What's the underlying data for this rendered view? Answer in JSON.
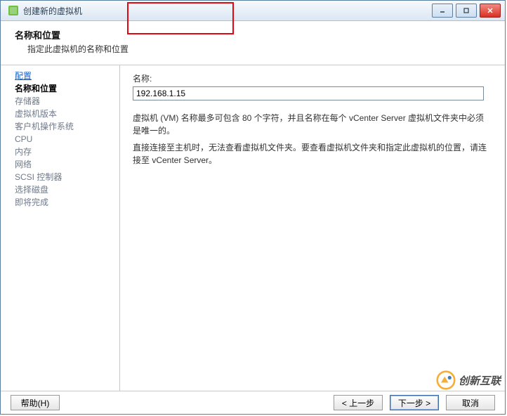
{
  "titlebar": {
    "title": "创建新的虚拟机",
    "min_icon": "min",
    "max_icon": "max",
    "close_icon": "x"
  },
  "header": {
    "title": "名称和位置",
    "subtitle": "指定此虚拟机的名称和位置"
  },
  "sidebar": {
    "items": [
      {
        "label": "配置",
        "state": "link"
      },
      {
        "label": "名称和位置",
        "state": "current"
      },
      {
        "label": "存储器",
        "state": "pending"
      },
      {
        "label": "虚拟机版本",
        "state": "pending"
      },
      {
        "label": "客户机操作系统",
        "state": "pending"
      },
      {
        "label": "CPU",
        "state": "pending"
      },
      {
        "label": "内存",
        "state": "pending"
      },
      {
        "label": "网络",
        "state": "pending"
      },
      {
        "label": "SCSI 控制器",
        "state": "pending"
      },
      {
        "label": "选择磁盘",
        "state": "pending"
      },
      {
        "label": "即将完成",
        "state": "pending"
      }
    ]
  },
  "content": {
    "name_label": "名称:",
    "name_value": "192.168.1.15",
    "desc1": "虚拟机 (VM) 名称最多可包含 80 个字符，并且名称在每个 vCenter Server 虚拟机文件夹中必须是唯一的。",
    "desc2": "直接连接至主机时，无法查看虚拟机文件夹。要查看虚拟机文件夹和指定此虚拟机的位置，请连接至 vCenter Server。"
  },
  "footer": {
    "help": "帮助(H)",
    "back": "< 上一步",
    "next": "下一步 >",
    "cancel": "取消"
  },
  "watermark": {
    "text": "创新互联"
  }
}
